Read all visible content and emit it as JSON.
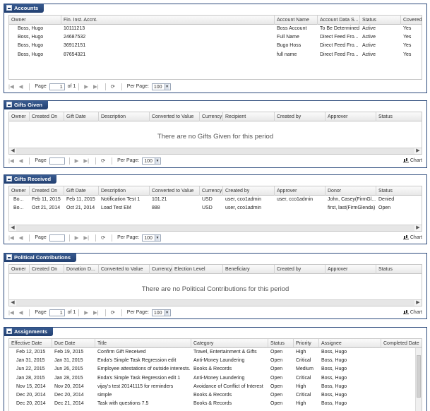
{
  "pager": {
    "page_label": "Page",
    "page_value": "1",
    "of_text": "of 1",
    "per_page_label": "Per Page:",
    "per_page_value": "100",
    "chart_label": "Chart"
  },
  "accounts": {
    "title": "Accounts",
    "columns": [
      "Owner",
      "Fin. Inst. Accnt.",
      "Account Name",
      "Account Data S...",
      "Status",
      "Covered"
    ],
    "rows": [
      [
        "Boss, Hugo",
        "10111213",
        "Boss Account",
        "To Be Determined",
        "Active",
        "Yes"
      ],
      [
        "Boss, Hugo",
        "24687532",
        "Full Name",
        "Direct Feed Fro...",
        "Active",
        "Yes"
      ],
      [
        "Boss, Hugo",
        "36912151",
        "Bugo Hoss",
        "Direct Feed Fro...",
        "Active",
        "Yes"
      ],
      [
        "Boss, Hugo",
        "87654321",
        "full name",
        "Direct Feed Fro...",
        "Active",
        "Yes"
      ]
    ]
  },
  "gifts_given": {
    "title": "Gifts Given",
    "columns": [
      "Owner",
      "Created On",
      "Gift Date",
      "Description",
      "Converted to Value",
      "Currency",
      "Recipient",
      "Created by",
      "Approver",
      "Status"
    ],
    "empty_text": "There are no Gifts Given for this period"
  },
  "gifts_received": {
    "title": "Gifts Received",
    "columns": [
      "Owner",
      "Created On",
      "Gift Date",
      "Description",
      "Converted to Value",
      "Currency",
      "Created by",
      "Approver",
      "Donor",
      "Status"
    ],
    "rows": [
      [
        "Bo...",
        "Feb 11, 2015",
        "Feb 11, 2015",
        "Notification Test 1",
        "101.21",
        "USD",
        "user, cco1admin",
        "user, cco1admin",
        "John, Casey(FirmGl...",
        "Denied"
      ],
      [
        "Bo...",
        "Oct 21, 2014",
        "Oct 21, 2014",
        "Load Test EM",
        "888",
        "USD",
        "user, cco1admin",
        "",
        "first, last(FirmGlenda)",
        "Open"
      ]
    ]
  },
  "political": {
    "title": "Political Contributions",
    "columns": [
      "Owner",
      "Created On",
      "Donation D...",
      "Converted to Value",
      "Currency",
      "Election Level",
      "Beneficiary",
      "Created by",
      "Approver",
      "Status"
    ],
    "empty_text": "There are no Political Contributions for this period"
  },
  "assignments": {
    "title": "Assignments",
    "columns": [
      "Effective Date",
      "Due Date",
      "Title",
      "Category",
      "Status",
      "Priority",
      "Assignee",
      "Completed Date"
    ],
    "rows": [
      [
        "Feb 12, 2015",
        "Feb 19, 2015",
        "Confirm Gift Received",
        "Travel, Entertainment & Gifts",
        "Open",
        "High",
        "Boss, Hugo",
        ""
      ],
      [
        "Jan 31, 2015",
        "Jan 31, 2015",
        "Enda's Simple Task Regression edit",
        "Anti-Money Laundering",
        "Open",
        "Critical",
        "Boss, Hugo",
        ""
      ],
      [
        "Jun 22, 2015",
        "Jun 26, 2015",
        "Employee attestations of outside interests.",
        "Books & Records",
        "Open",
        "Medium",
        "Boss, Hugo",
        ""
      ],
      [
        "Jan 28, 2015",
        "Jan 28, 2015",
        "Enda's Simple Task Regression edit 1",
        "Anti-Money Laundering",
        "Open",
        "Critical",
        "Boss, Hugo",
        ""
      ],
      [
        "Nov 15, 2014",
        "Nov 20, 2014",
        "vijay's test 20141115 for reminders",
        "Avoidance of Conflict of Interest",
        "Open",
        "High",
        "Boss, Hugo",
        ""
      ],
      [
        "Dec 20, 2014",
        "Dec 20, 2014",
        "simple",
        "Books & Records",
        "Open",
        "Critical",
        "Boss, Hugo",
        ""
      ],
      [
        "Dec 20, 2014",
        "Dec 21, 2014",
        "Task with questions 7.5",
        "Books & Records",
        "Open",
        "High",
        "Boss, Hugo",
        ""
      ]
    ]
  }
}
